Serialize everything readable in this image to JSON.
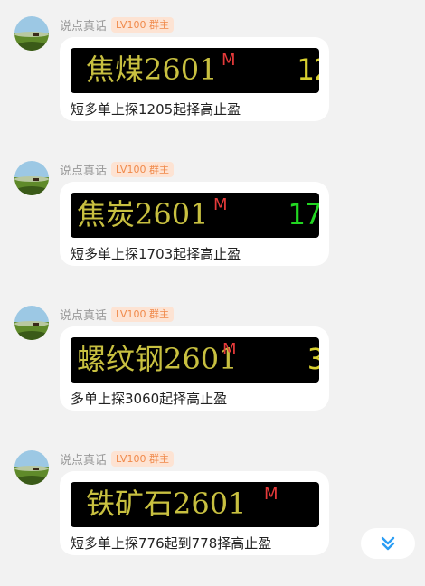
{
  "messages": [
    {
      "username": "说点真话",
      "badge": "LV100 群主",
      "ticker_name": "焦煤2601",
      "ticker_flag": "M",
      "ticker_price": "12",
      "price_color": "#d8d030",
      "text": "短多单上探1205起择高止盈"
    },
    {
      "username": "说点真话",
      "badge": "LV100 群主",
      "ticker_name": "焦炭2601",
      "ticker_flag": "M",
      "ticker_price": "17",
      "price_color": "#22d622",
      "text": "短多单上探1703起择高止盈"
    },
    {
      "username": "说点真话",
      "badge": "LV100 群主",
      "ticker_name": "螺纹钢2601",
      "ticker_flag": "M",
      "ticker_price": "3",
      "price_color": "#d8d030",
      "text": "多单上探3060起择高止盈"
    },
    {
      "username": "说点真话",
      "badge": "LV100 群主",
      "ticker_name": "铁矿石2601",
      "ticker_flag": "M",
      "ticker_price": "",
      "price_color": "#d8d030",
      "text": "短多单上探776起到778择高止盈"
    }
  ],
  "scroll_button_icon": "double-chevron-down-icon",
  "colors": {
    "accent": "#2a9df4",
    "badge_text": "#f08a4b",
    "badge_bg": "#fde3d3",
    "ticker_name": "#c8c040",
    "ticker_flag": "#e63a3a"
  }
}
